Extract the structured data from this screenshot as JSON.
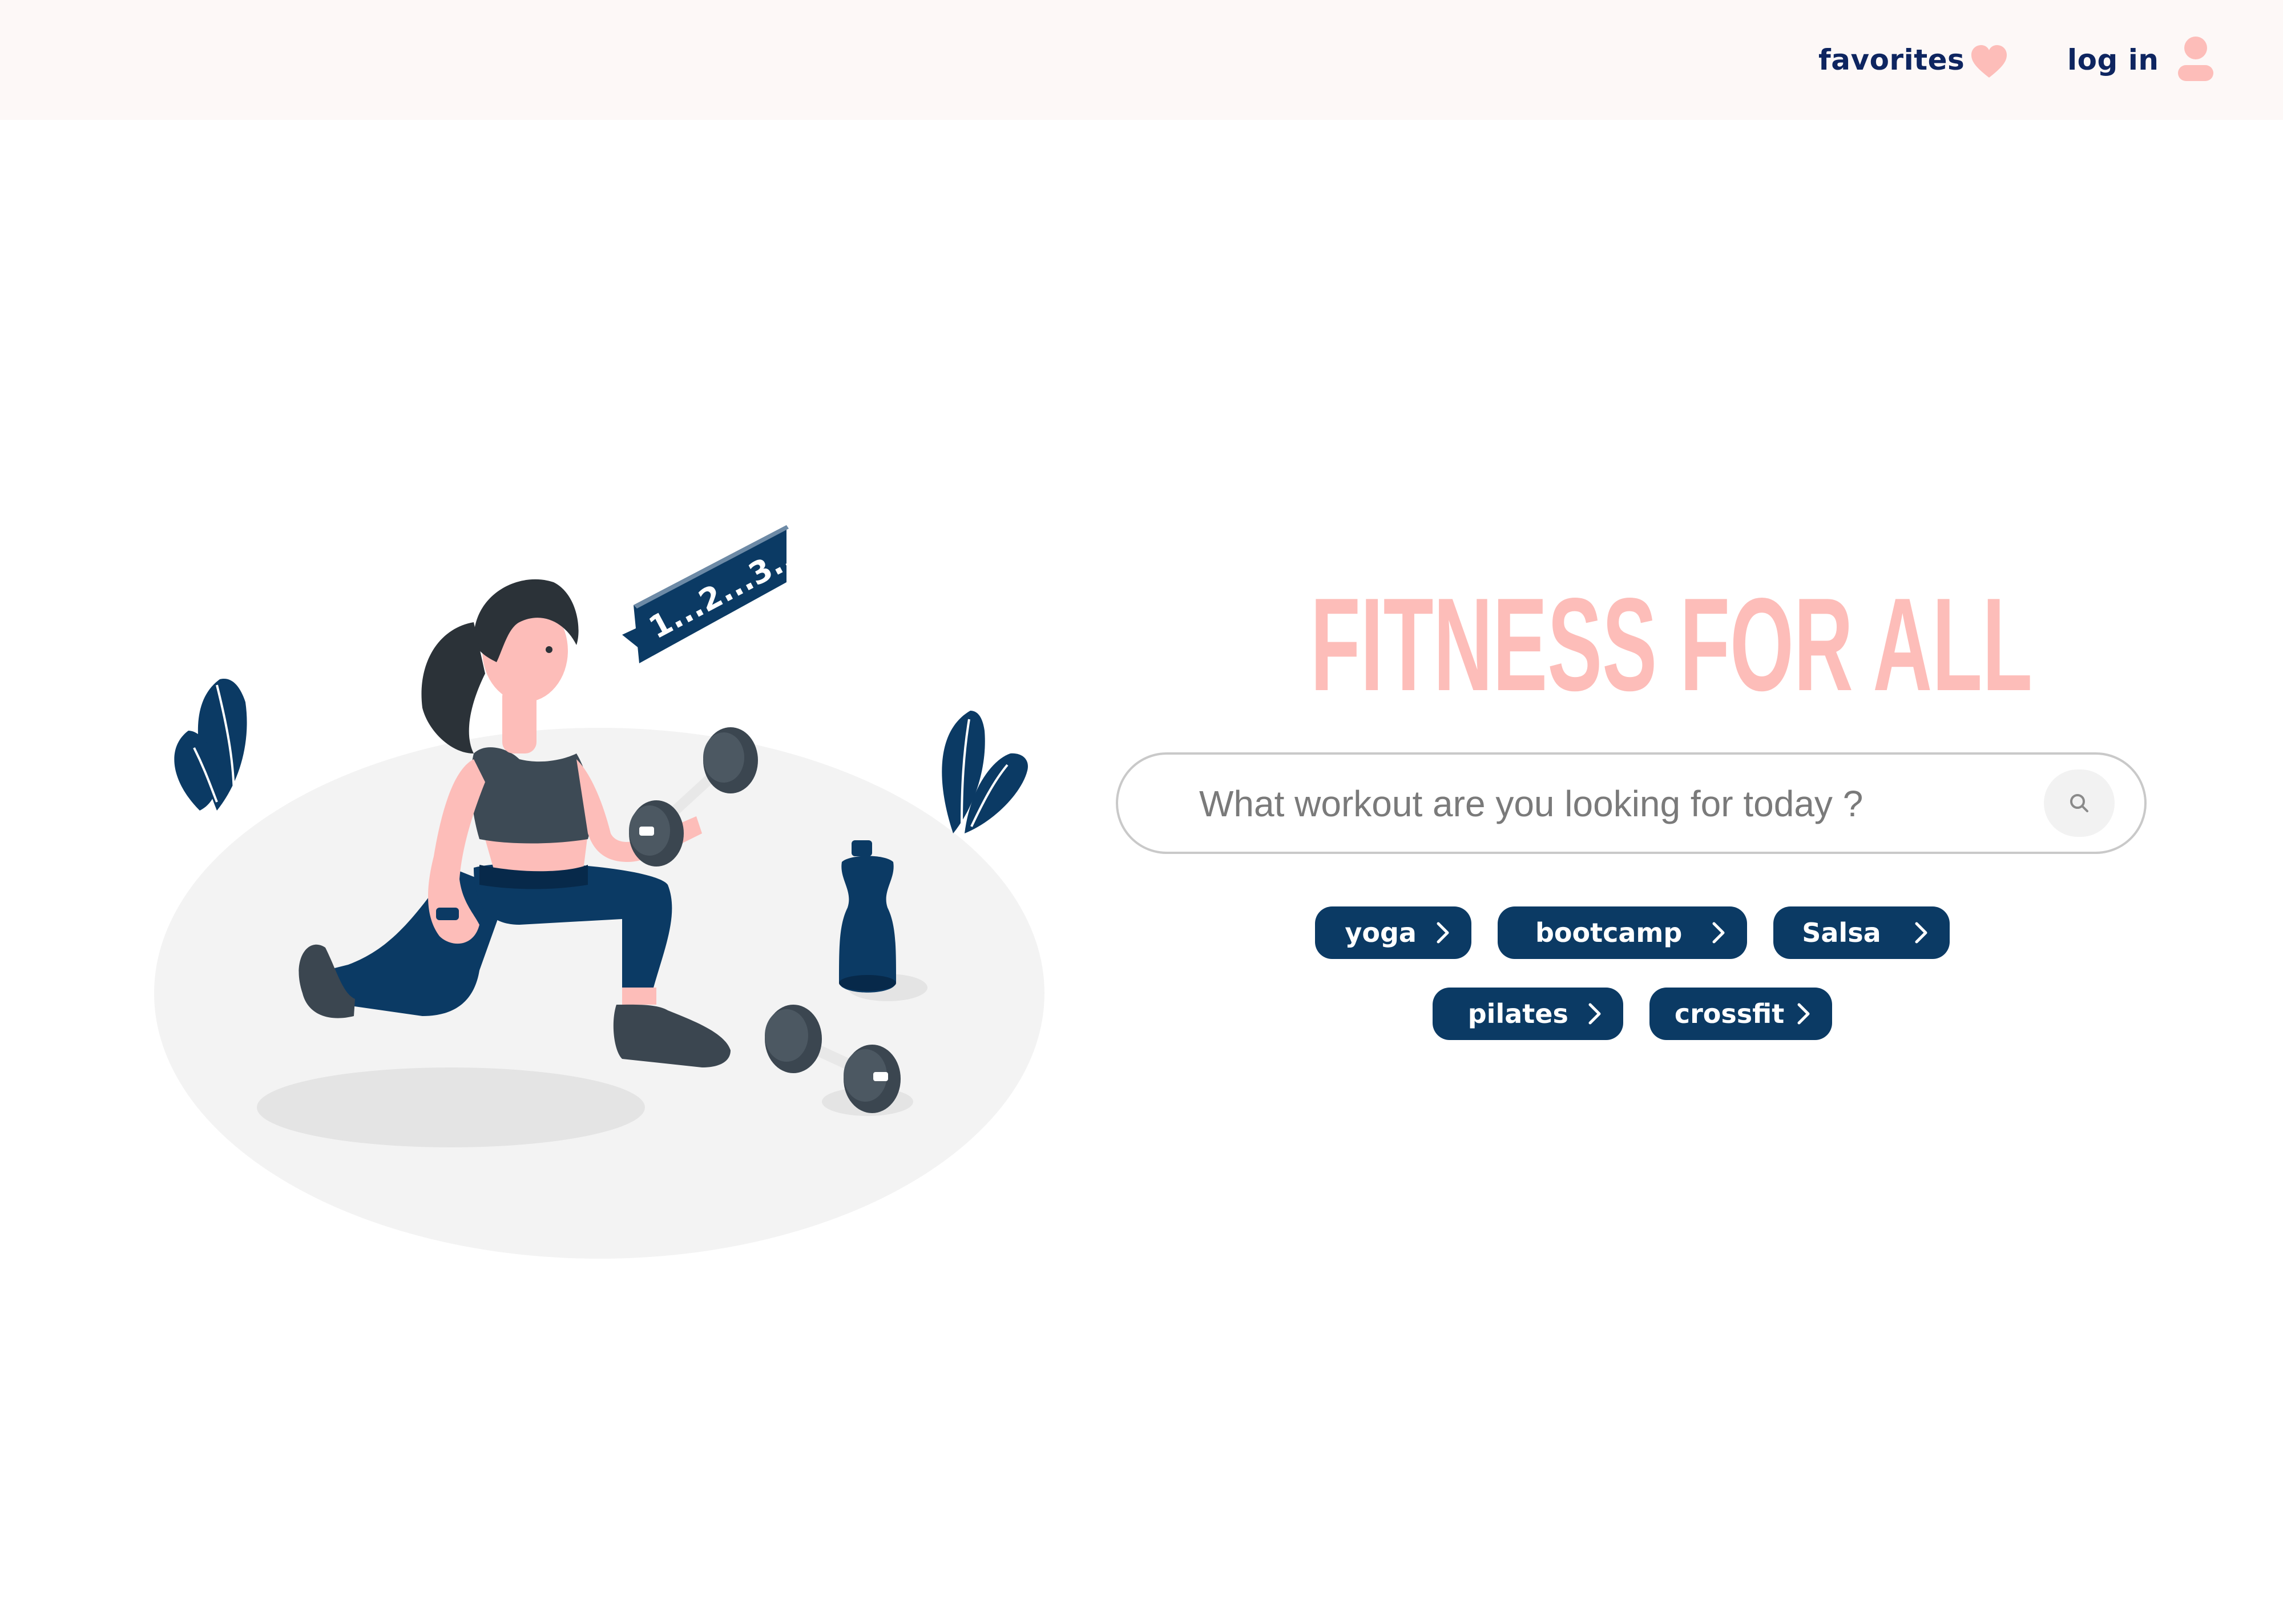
{
  "header": {
    "favorites_label": "favorites",
    "login_label": "log in",
    "favorites_icon": "heart-icon",
    "login_icon": "user-icon"
  },
  "hero": {
    "title": "FITNESS FOR ALL"
  },
  "search": {
    "placeholder": "What workout are you looking for today ?",
    "icon": "search-icon"
  },
  "tags": [
    {
      "label": "yoga"
    },
    {
      "label": "bootcamp"
    },
    {
      "label": "Salsa"
    },
    {
      "label": "pilates"
    },
    {
      "label": "crossfit"
    }
  ],
  "illustration": {
    "counter_text": "1...2...3..."
  },
  "colors": {
    "header_bg": "#fdf8f7",
    "nav_text": "#0e2560",
    "accent_pink": "#fdbdb9",
    "tag_bg": "#0b3a64",
    "search_border": "#c9c9c9"
  }
}
